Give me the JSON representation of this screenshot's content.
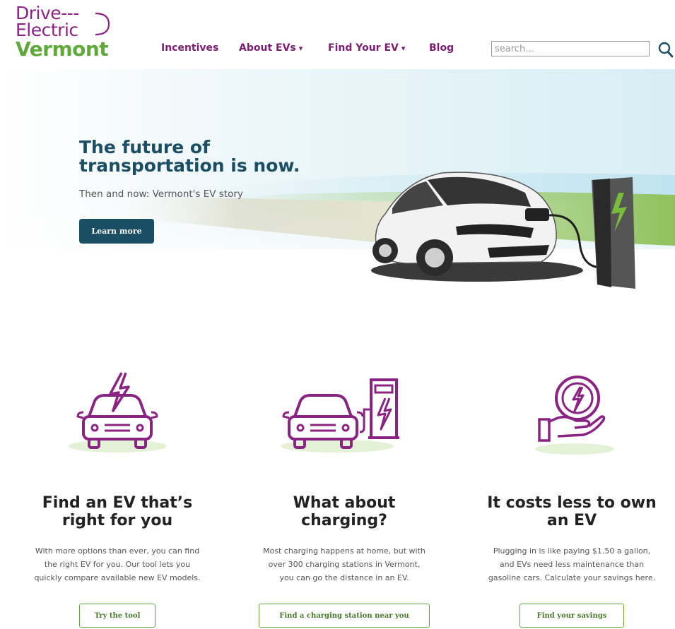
{
  "logo": {
    "line1": "Drive---",
    "line2": "Electric",
    "line3": "Vermont"
  },
  "nav": {
    "items": [
      {
        "label": "Incentives",
        "caret": ""
      },
      {
        "label": "About EVs",
        "caret": "▾"
      },
      {
        "label": "Find Your EV",
        "caret": "▾"
      },
      {
        "label": "Blog",
        "caret": ""
      }
    ]
  },
  "search": {
    "placeholder": "search...",
    "icon": "search-icon"
  },
  "hero": {
    "title_line1": "The future of",
    "title_line2": "transportation is now.",
    "subtitle": "Then and now: Vermont's EV story",
    "button": "Learn more"
  },
  "features": [
    {
      "title_line1": "Find an EV that’s",
      "title_line2": "right for you",
      "desc_line1": "With more options than ever, you can find",
      "desc_line2": "the right EV for you. Our tool lets you",
      "desc_line3": "quickly compare available new EV models.",
      "button": "Try the tool",
      "icon": "electric-car-icon"
    },
    {
      "title_line1": "What about",
      "title_line2": "charging?",
      "desc_line1": "Most charging happens at home, but with",
      "desc_line2": "over 300 charging stations in Vermont,",
      "desc_line3": "you can go the distance in an EV.",
      "button": "Find a charging station near you",
      "icon": "charging-station-icon"
    },
    {
      "title_line1": "It costs less to own",
      "title_line2": "an EV",
      "desc_line1": "Plugging in is like paying $1.50 a gallon,",
      "desc_line2": "and EVs need less maintenance than",
      "desc_line3": "gasoline cars. Calculate your savings here.",
      "button": "Find your savings",
      "icon": "savings-hand-icon"
    }
  ],
  "colors": {
    "brand_purple": "#8a2482",
    "brand_green": "#5fa83a",
    "hero_blue": "#1c4e63"
  }
}
